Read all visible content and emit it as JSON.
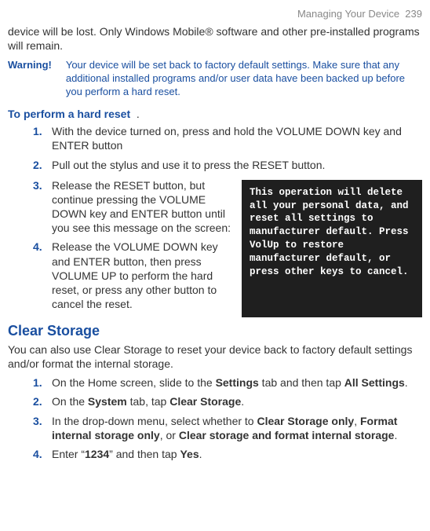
{
  "header": {
    "section": "Managing Your Device",
    "page": "239"
  },
  "intro": "device will be lost. Only Windows Mobile® software and other pre-installed programs will remain.",
  "warning": {
    "label": "Warning!",
    "text": "Your device will be set back to factory default settings. Make sure that any additional installed programs and/or user data have been backed up before you perform a hard reset."
  },
  "hardReset": {
    "title": "To perform a hard reset",
    "dot": ".",
    "steps": [
      "With the device turned on, press and hold the VOLUME DOWN key and ENTER button",
      "Pull out the stylus and use it to press the RESET button.",
      "Release the RESET button, but continue pressing the VOLUME DOWN key and ENTER button until you see this message on the screen:",
      "Release the VOLUME DOWN key and ENTER button, then press VOLUME UP to perform the hard reset, or press any other button to cancel the reset."
    ],
    "screenMessage": "This operation will delete all your personal data, and reset all settings to manufacturer default. Press VolUp to restore manufacturer default, or press other keys to cancel."
  },
  "clearStorage": {
    "title": "Clear Storage",
    "intro": "You can also use Clear Storage to reset your device back to factory default settings and/or format the internal storage.",
    "step1_a": "On the Home screen, slide to the ",
    "step1_b": "Settings",
    "step1_c": " tab and then tap ",
    "step1_d": "All Settings",
    "step1_e": ".",
    "step2_a": "On the ",
    "step2_b": "System",
    "step2_c": " tab, tap ",
    "step2_d": "Clear Storage",
    "step2_e": ".",
    "step3_a": "In the drop-down menu, select whether to ",
    "step3_b": "Clear Storage only",
    "step3_c": ", ",
    "step3_d": "Format internal storage only",
    "step3_e": ", or ",
    "step3_f": "Clear storage and format internal storage",
    "step3_g": ".",
    "step4_a": "Enter “",
    "step4_b": "1234",
    "step4_c": "” and then tap ",
    "step4_d": "Yes",
    "step4_e": "."
  }
}
